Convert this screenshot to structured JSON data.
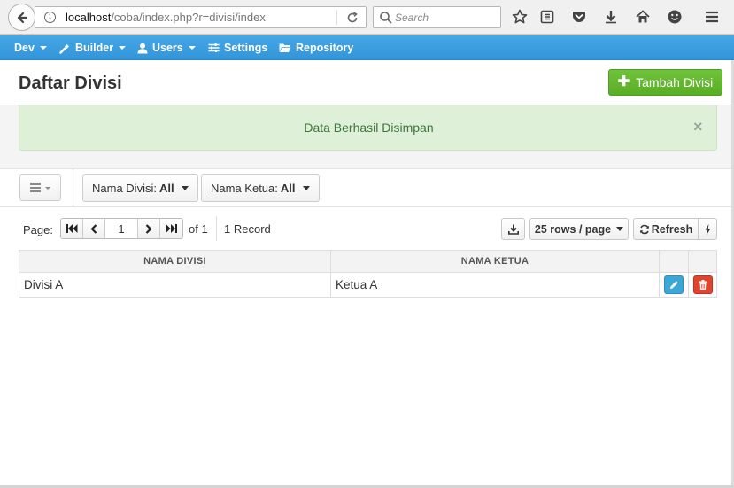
{
  "browser": {
    "url_host": "localhost",
    "url_path": "/coba/index.php?r=divisi/index",
    "search_placeholder": "Search",
    "icons": [
      "back-arrow-icon",
      "info-icon",
      "reload-icon",
      "search-icon",
      "bookmark-star-icon",
      "reading-list-icon",
      "pocket-icon",
      "download-icon",
      "home-icon",
      "emoji-icon",
      "hamburger-menu-icon"
    ]
  },
  "navbar": {
    "color": "#3396d9",
    "items": [
      {
        "label": "Dev",
        "icon": "",
        "dropdown": true
      },
      {
        "label": "Builder",
        "icon": "wrench-icon",
        "dropdown": true
      },
      {
        "label": "Users",
        "icon": "user-icon",
        "dropdown": true
      },
      {
        "label": "Settings",
        "icon": "sliders-icon",
        "dropdown": false
      },
      {
        "label": "Repository",
        "icon": "folder-open-icon",
        "dropdown": false
      }
    ]
  },
  "header": {
    "title": "Daftar Divisi",
    "add_button_label": "Tambah Divisi",
    "add_button_color": "#5aae26"
  },
  "alert": {
    "message": "Data Berhasil Disimpan",
    "close_symbol": "×",
    "bg_color": "#dff0d8",
    "text_color": "#3c763d"
  },
  "filters": [
    {
      "label": "Nama Divisi:",
      "value": "All"
    },
    {
      "label": "Nama Ketua:",
      "value": "All"
    }
  ],
  "pager": {
    "label": "Page:",
    "current_page": "1",
    "of_text": "of 1",
    "record_text": "1 Record",
    "rows_per_page_label": "25 rows / page",
    "refresh_label": "Refresh"
  },
  "table": {
    "columns": [
      "NAMA DIVISI",
      "NAMA KETUA"
    ],
    "rows": [
      {
        "nama_divisi": "Divisi A",
        "nama_ketua": "Ketua A"
      }
    ],
    "edit_color": "#3ca6d6",
    "delete_color": "#e0442f"
  }
}
